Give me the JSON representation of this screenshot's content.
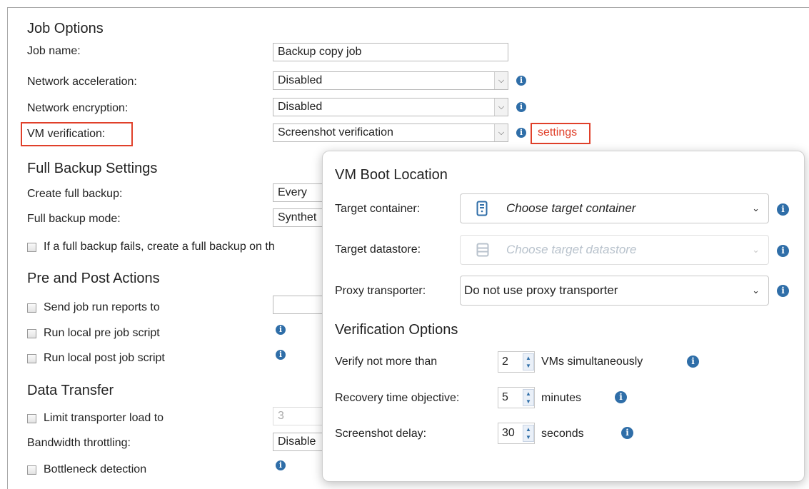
{
  "job_options": {
    "title": "Job Options",
    "job_name_label": "Job name:",
    "job_name_value": "Backup copy job",
    "network_acceleration_label": "Network acceleration:",
    "network_acceleration_value": "Disabled",
    "network_encryption_label": "Network encryption:",
    "network_encryption_value": "Disabled",
    "vm_verification_label": "VM verification:",
    "vm_verification_value": "Screenshot verification",
    "settings_link": "settings"
  },
  "full_backup": {
    "title": "Full Backup Settings",
    "create_full_label": "Create full backup:",
    "create_full_value": "Every",
    "mode_label": "Full backup mode:",
    "mode_value": "Synthet",
    "fail_checkbox_label": "If a full backup fails, create a full backup on th"
  },
  "pre_post": {
    "title": "Pre and Post Actions",
    "send_reports_label": "Send job run reports to",
    "pre_script_label": "Run local pre job script",
    "post_script_label": "Run local post job script"
  },
  "data_transfer": {
    "title": "Data Transfer",
    "limit_label": "Limit transporter load to",
    "limit_value": "3",
    "bandwidth_label": "Bandwidth throttling:",
    "bandwidth_value": "Disable",
    "bottleneck_label": "Bottleneck detection"
  },
  "popup": {
    "boot_title": "VM Boot Location",
    "target_container_label": "Target container:",
    "target_container_placeholder": "Choose target container",
    "target_datastore_label": "Target datastore:",
    "target_datastore_placeholder": "Choose target datastore",
    "proxy_label": "Proxy transporter:",
    "proxy_value": "Do not use proxy transporter",
    "verification_title": "Verification Options",
    "verify_label": "Verify not more than",
    "verify_value": "2",
    "verify_unit": "VMs simultaneously",
    "rto_label": "Recovery time objective:",
    "rto_value": "5",
    "rto_unit": "minutes",
    "delay_label": "Screenshot delay:",
    "delay_value": "30",
    "delay_unit": "seconds"
  },
  "colors": {
    "highlight": "#e0402a",
    "info_icon": "#2f6ea8"
  }
}
